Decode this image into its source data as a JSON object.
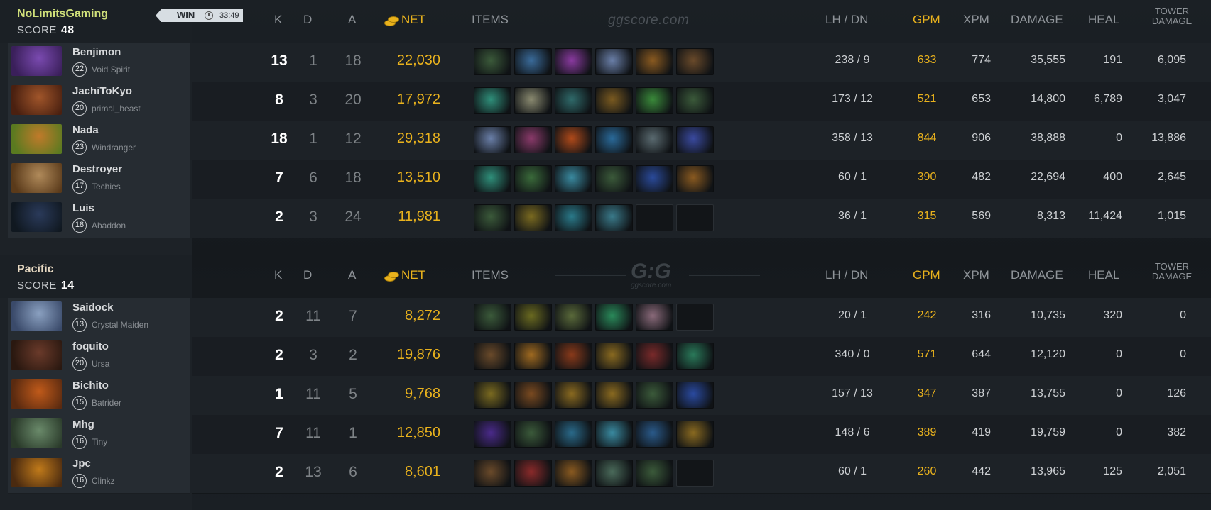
{
  "header": {
    "k": "K",
    "d": "D",
    "a": "A",
    "net": "NET",
    "items": "ITEMS",
    "lh_dn": "LH  /  DN",
    "gpm": "GPM",
    "xpm": "XPM",
    "damage": "DAMAGE",
    "heal": "HEAL",
    "tower_damage": "TOWER DAMAGE"
  },
  "watermark": {
    "text": "ggscore.com",
    "logo": "G:G",
    "sub": "ggscore.com"
  },
  "colors": {
    "gold": "#e9b21d",
    "win_badge": "#d7dde2"
  },
  "teams": [
    {
      "name": "NoLimitsGaming",
      "name_color": "#d0e07a",
      "score_label": "SCORE",
      "score": "48",
      "result": "WIN",
      "duration": "33:49",
      "players": [
        {
          "name": "Benjimon",
          "level": "22",
          "hero": "Void Spirit",
          "k": "13",
          "d": "1",
          "a": "18",
          "net": "22,030",
          "lh_dn": "238  /  9",
          "gpm": "633",
          "xpm": "774",
          "damage": "35,555",
          "heal": "191",
          "tower": "6,095",
          "items": [
            "#3b5a3a",
            "#3a6b9a",
            "#8a3aa0",
            "#6a7fa8",
            "#8a5a20",
            "#6a4a2a"
          ],
          "portrait": [
            "#7a4ab0",
            "#3a1f5a"
          ]
        },
        {
          "name": "JachiToKyo",
          "level": "20",
          "hero": "primal_beast",
          "k": "8",
          "d": "3",
          "a": "20",
          "net": "17,972",
          "lh_dn": "173  /  12",
          "gpm": "521",
          "xpm": "653",
          "damage": "14,800",
          "heal": "6,789",
          "tower": "3,047",
          "items": [
            "#2f8f7a",
            "#8a8a70",
            "#2f6a6a",
            "#7a5a20",
            "#3a8a3a",
            "#3b5a3a"
          ],
          "portrait": [
            "#a0552a",
            "#4a2010"
          ]
        },
        {
          "name": "Nada",
          "level": "23",
          "hero": "Windranger",
          "k": "18",
          "d": "1",
          "a": "12",
          "net": "29,318",
          "lh_dn": "358  /  13",
          "gpm": "844",
          "xpm": "906",
          "damage": "38,888",
          "heal": "0",
          "tower": "13,886",
          "items": [
            "#6a7fa8",
            "#8a3a6a",
            "#b04a1a",
            "#2a6a9a",
            "#5a6a70",
            "#3a4aa0"
          ],
          "portrait": [
            "#c07a2a",
            "#5a7a20"
          ]
        },
        {
          "name": "Destroyer",
          "level": "17",
          "hero": "Techies",
          "k": "7",
          "d": "6",
          "a": "18",
          "net": "13,510",
          "lh_dn": "60  /  1",
          "gpm": "390",
          "xpm": "482",
          "damage": "22,694",
          "heal": "400",
          "tower": "2,645",
          "items": [
            "#2f8f7a",
            "#3a6a3a",
            "#3a8aa0",
            "#3b5a3a",
            "#2a4a9a",
            "#8a5a20"
          ],
          "portrait": [
            "#b08a5a",
            "#5a3a1a"
          ]
        },
        {
          "name": "Luis",
          "level": "18",
          "hero": "Abaddon",
          "k": "2",
          "d": "3",
          "a": "24",
          "net": "11,981",
          "lh_dn": "36  /  1",
          "gpm": "315",
          "xpm": "569",
          "damage": "8,313",
          "heal": "11,424",
          "tower": "1,015",
          "items": [
            "#3b5a3a",
            "#7a6a20",
            "#2a7a8a",
            "#3a7a8a",
            "",
            ""
          ],
          "portrait": [
            "#2a3a5a",
            "#101820"
          ]
        }
      ]
    },
    {
      "name": "Pacific",
      "name_color": "#e7d9c2",
      "score_label": "SCORE",
      "score": "14",
      "players": [
        {
          "name": "Saidock",
          "level": "13",
          "hero": "Crystal Maiden",
          "k": "2",
          "d": "11",
          "a": "7",
          "net": "8,272",
          "lh_dn": "20  /  1",
          "gpm": "242",
          "xpm": "316",
          "damage": "10,735",
          "heal": "320",
          "tower": "0",
          "items": [
            "#3b5a3a",
            "#6a6a20",
            "#5a6a3a",
            "#2a8a5a",
            "#8a6a7a",
            ""
          ],
          "portrait": [
            "#8aa0c0",
            "#3a4a6a"
          ]
        },
        {
          "name": "foquito",
          "level": "20",
          "hero": "Ursa",
          "k": "2",
          "d": "3",
          "a": "2",
          "net": "19,876",
          "lh_dn": "340  /  0",
          "gpm": "571",
          "xpm": "644",
          "damage": "12,120",
          "heal": "0",
          "tower": "0",
          "items": [
            "#6a4a2a",
            "#a06a20",
            "#8a3a1a",
            "#8a6a20",
            "#7a2a2a",
            "#2a7a5a"
          ],
          "portrait": [
            "#6a3a2a",
            "#2a1810"
          ]
        },
        {
          "name": "Bichito",
          "level": "15",
          "hero": "Batrider",
          "k": "1",
          "d": "11",
          "a": "5",
          "net": "9,768",
          "lh_dn": "157  /  13",
          "gpm": "347",
          "xpm": "387",
          "damage": "13,755",
          "heal": "0",
          "tower": "126",
          "items": [
            "#7a6a20",
            "#7a4a20",
            "#8a6a20",
            "#8a6a20",
            "#3b5a3a",
            "#2a4aa0"
          ],
          "portrait": [
            "#c05a1a",
            "#5a2a10"
          ]
        },
        {
          "name": "Mhg",
          "level": "16",
          "hero": "Tiny",
          "k": "7",
          "d": "11",
          "a": "1",
          "net": "12,850",
          "lh_dn": "148  /  6",
          "gpm": "389",
          "xpm": "419",
          "damage": "19,759",
          "heal": "0",
          "tower": "382",
          "items": [
            "#4a2a8a",
            "#3b5a3a",
            "#2a6a8a",
            "#3a8aa0",
            "#2a5a8a",
            "#8a6a20"
          ],
          "portrait": [
            "#6a8a6a",
            "#2a3a2a"
          ]
        },
        {
          "name": "Jpc",
          "level": "16",
          "hero": "Clinkz",
          "k": "2",
          "d": "13",
          "a": "6",
          "net": "8,601",
          "lh_dn": "60  /  1",
          "gpm": "260",
          "xpm": "442",
          "damage": "13,965",
          "heal": "125",
          "tower": "2,051",
          "items": [
            "#6a4a2a",
            "#8a2a2a",
            "#8a5a20",
            "#4a6a5a",
            "#3b5a3a",
            ""
          ],
          "portrait": [
            "#c07a1a",
            "#4a2a10"
          ]
        }
      ]
    }
  ]
}
